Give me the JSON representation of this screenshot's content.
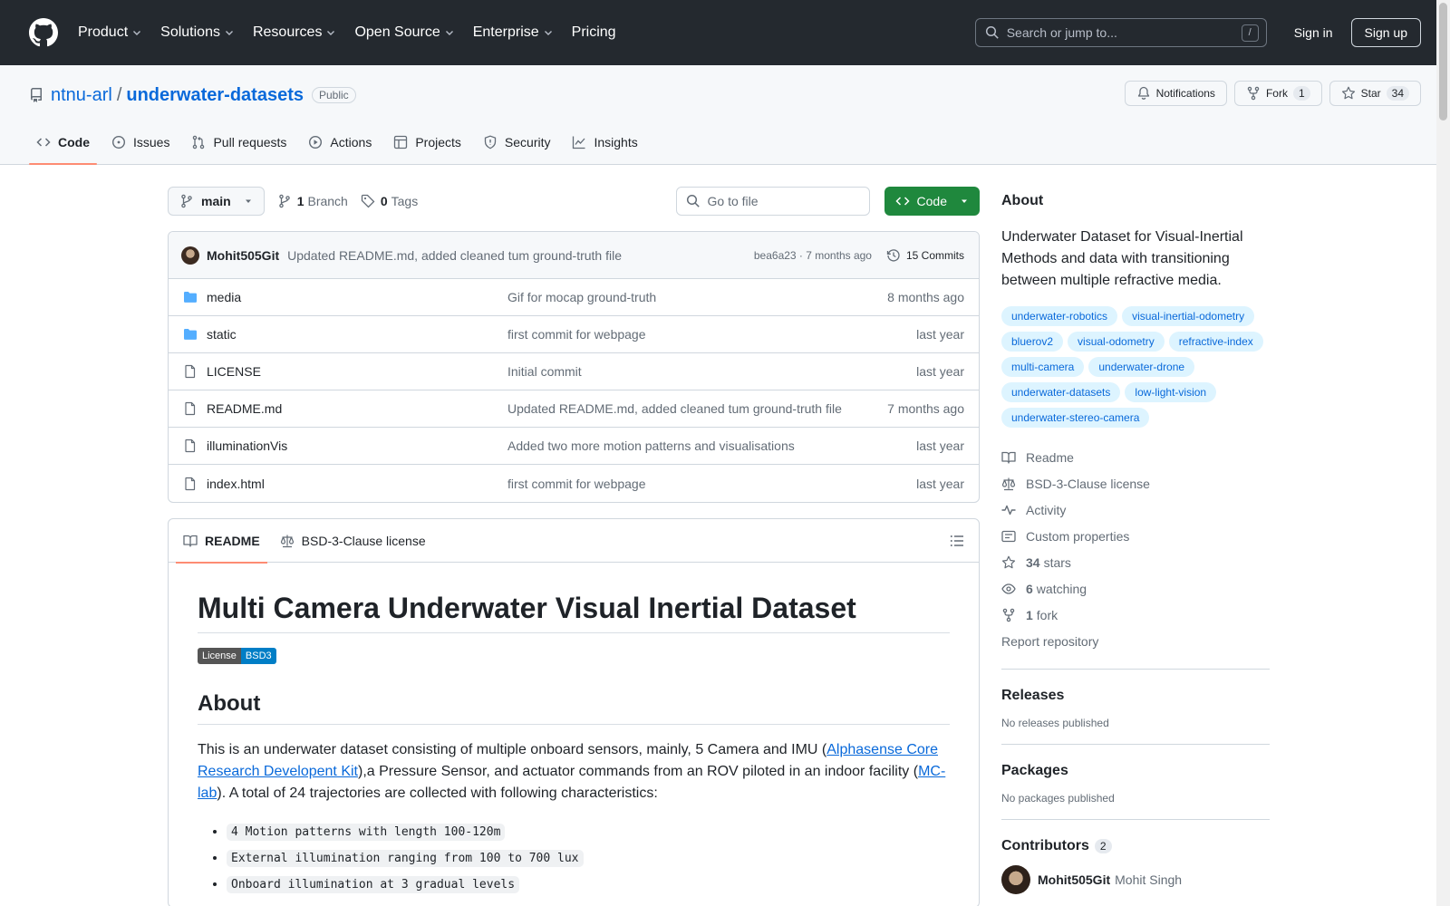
{
  "header": {
    "nav": [
      "Product",
      "Solutions",
      "Resources",
      "Open Source",
      "Enterprise",
      "Pricing"
    ],
    "search_placeholder": "Search or jump to...",
    "search_key": "/",
    "signin": "Sign in",
    "signup": "Sign up"
  },
  "repo": {
    "owner": "ntnu-arl",
    "separator": "/",
    "name": "underwater-datasets",
    "visibility": "Public",
    "notifications": "Notifications",
    "fork_label": "Fork",
    "fork_count": "1",
    "star_label": "Star",
    "star_count": "34",
    "tabs": [
      "Code",
      "Issues",
      "Pull requests",
      "Actions",
      "Projects",
      "Security",
      "Insights"
    ]
  },
  "toolbar": {
    "branch": "main",
    "branch_count": "1",
    "branch_label": "Branch",
    "tag_count": "0",
    "tag_label": "Tags",
    "goto_placeholder": "Go to file",
    "code_label": "Code"
  },
  "commit": {
    "author": "Mohit505Git",
    "message": "Updated README.md, added cleaned tum ground-truth file",
    "meta": "bea6a23 · 7 months ago",
    "commits": "15 Commits"
  },
  "files": [
    {
      "name": "media",
      "type": "folder",
      "message": "Gif for mocap ground-truth",
      "date": "8 months ago"
    },
    {
      "name": "static",
      "type": "folder",
      "message": "first commit for webpage",
      "date": "last year"
    },
    {
      "name": "LICENSE",
      "type": "file",
      "message": "Initial commit",
      "date": "last year"
    },
    {
      "name": "README.md",
      "type": "file",
      "message": "Updated README.md, added cleaned tum ground-truth file",
      "date": "7 months ago"
    },
    {
      "name": "illuminationVis",
      "type": "file",
      "message": "Added two more motion patterns and visualisations",
      "date": "last year"
    },
    {
      "name": "index.html",
      "type": "file",
      "message": "first commit for webpage",
      "date": "last year"
    }
  ],
  "readme": {
    "tab_readme": "README",
    "tab_license": "BSD-3-Clause license",
    "title": "Multi Camera Underwater Visual Inertial Dataset",
    "badge_left": "License",
    "badge_right": "BSD3",
    "h_about": "About",
    "p1_a": "This is an underwater dataset consisting of multiple onboard sensors, mainly, 5 Camera and IMU (",
    "link1": "Alphasense Core Research Developent Kit",
    "p1_b": "),a Pressure Sensor, and actuator commands from an ROV piloted in an indoor facility (",
    "link2": "MC-lab",
    "p1_c": "). A total of 24 trajectories are collected with following characteristics:",
    "bullets": [
      "4 Motion patterns with length 100-120m",
      "External illumination ranging from 100 to 700 lux",
      "Onboard illumination at 3 gradual levels"
    ]
  },
  "sidebar": {
    "about_title": "About",
    "description": "Underwater Dataset for Visual-Inertial Methods and data with transitioning between multiple refractive media.",
    "topics": [
      "underwater-robotics",
      "visual-inertial-odometry",
      "bluerov2",
      "visual-odometry",
      "refractive-index",
      "multi-camera",
      "underwater-drone",
      "underwater-datasets",
      "low-light-vision",
      "underwater-stereo-camera"
    ],
    "links": {
      "readme": "Readme",
      "license": "BSD-3-Clause license",
      "activity": "Activity",
      "custom": "Custom properties",
      "stars_n": "34",
      "stars": "stars",
      "watching_n": "6",
      "watching": "watching",
      "fork_n": "1",
      "fork": "fork",
      "report": "Report repository"
    },
    "releases_title": "Releases",
    "releases_none": "No releases published",
    "packages_title": "Packages",
    "packages_none": "No packages published",
    "contributors_title": "Contributors",
    "contributors_count": "2",
    "contributor_login": "Mohit505Git",
    "contributor_name": "Mohit Singh"
  },
  "colors": {
    "header_bg": "#24292f",
    "link": "#0969da",
    "code_button": "#1f883d",
    "active_tab_underline": "#fd8c73",
    "folder": "#54aeff"
  }
}
